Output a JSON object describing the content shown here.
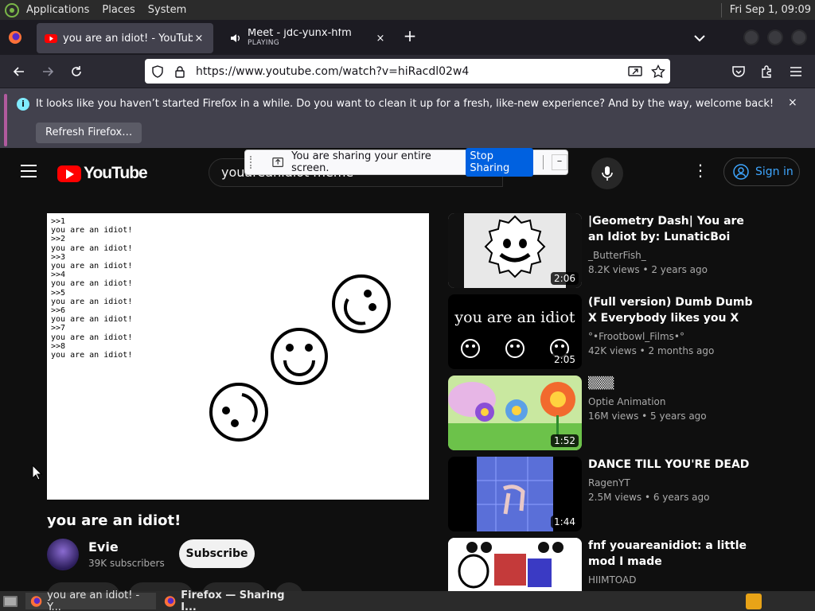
{
  "panel": {
    "menus": [
      "Applications",
      "Places",
      "System"
    ],
    "clock": "Fri Sep  1, 09:09"
  },
  "tabs": [
    {
      "title": "you are an idiot! - YouTube",
      "close": "×"
    },
    {
      "title": "Meet - jdc-yunx-hfm",
      "status": "PLAYING",
      "close": "×"
    }
  ],
  "newtab": "+",
  "urlbar": {
    "url": "https://www.youtube.com/watch?v=hiRacdl02w4"
  },
  "notification": {
    "message": "It looks like you haven’t started Firefox in a while. Do you want to clean it up for a fresh, like-new experience? And by the way, welcome back!",
    "button": "Refresh Firefox…",
    "close": "×"
  },
  "sharing": {
    "message": "You are sharing your entire screen.",
    "stop": "Stop Sharing",
    "minimize": "–"
  },
  "youtube": {
    "logo": "YouTube",
    "search_value": "youareanidiot meme",
    "signin": "Sign in",
    "video_text": ">>1\nyou are an idiot!\n>>2\nyou are an idiot!\n>>3\nyou are an idiot!\n>>4\nyou are an idiot!\n>>5\nyou are an idiot!\n>>6\nyou are an idiot!\n>>7\nyou are an idiot!\n>>8\nyou are an idiot!",
    "video_title": "you are an idiot!",
    "channel": "Evie",
    "subscribers": "39K subscribers",
    "subscribe": "Subscribe"
  },
  "recommendations": [
    {
      "title": "|Geometry Dash| You are an Idiot by: LunaticBoi (Unique...",
      "channel": "_ButterFish_",
      "meta": "8.2K views  •  2 years ago",
      "duration": "2:06",
      "thumb_text": ""
    },
    {
      "title": "(Full version) Dumb Dumb X Everybody likes you X You are...",
      "channel": "°•Frootbowl_Films•°",
      "meta": "42K views  •  2 months ago",
      "duration": "2:05",
      "thumb_text": "you are an idiot"
    },
    {
      "title": "▒▒▒",
      "channel": "Optie Animation",
      "meta": "16M views  •  5 years ago",
      "duration": "1:52",
      "thumb_text": ""
    },
    {
      "title": "DANCE TILL YOU'RE DEAD",
      "channel": "RagenYT",
      "meta": "2.5M views  •  6 years ago",
      "duration": "1:44",
      "thumb_text": ""
    },
    {
      "title": "fnf youareanidiot: a little mod I made",
      "channel": "HIIMTOAD",
      "meta": "",
      "duration": "",
      "thumb_text": ""
    }
  ],
  "taskbar": [
    {
      "title": "you are an idiot! - Y..."
    },
    {
      "title": "Firefox — Sharing I..."
    }
  ],
  "colors": {
    "accent": "#3ea6ff",
    "share_button": "#0061e0",
    "yt_red": "#ff0000"
  }
}
